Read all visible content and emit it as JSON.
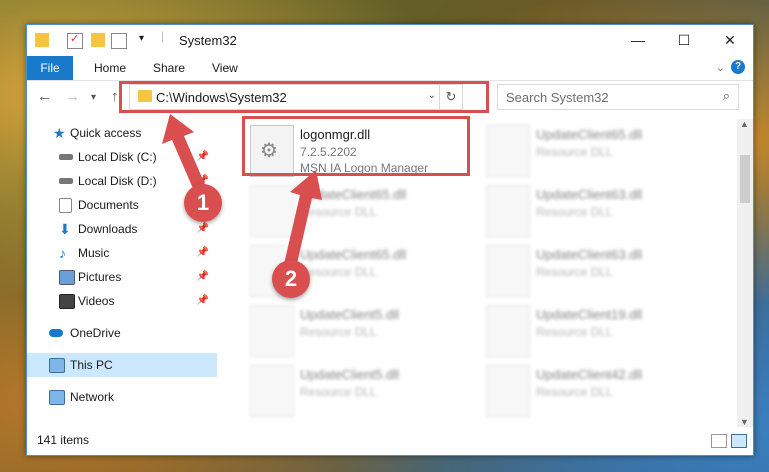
{
  "window": {
    "title": "System32"
  },
  "ribbon": {
    "tabs": [
      "File",
      "Home",
      "Share",
      "View"
    ]
  },
  "address": {
    "path": "C:\\Windows\\System32",
    "search_placeholder": "Search System32"
  },
  "sidebar": {
    "items": [
      {
        "label": "Quick access",
        "icon": "star-icon",
        "pinned": false
      },
      {
        "label": "Local Disk (C:)",
        "icon": "drive-icon",
        "pinned": true
      },
      {
        "label": "Local Disk (D:)",
        "icon": "drive-icon",
        "pinned": true
      },
      {
        "label": "Documents",
        "icon": "documents-icon",
        "pinned": true
      },
      {
        "label": "Downloads",
        "icon": "downloads-icon",
        "pinned": true
      },
      {
        "label": "Music",
        "icon": "music-icon",
        "pinned": true
      },
      {
        "label": "Pictures",
        "icon": "pictures-icon",
        "pinned": true
      },
      {
        "label": "Videos",
        "icon": "videos-icon",
        "pinned": true
      },
      {
        "label": "OneDrive",
        "icon": "cloud-icon",
        "pinned": false
      },
      {
        "label": "This PC",
        "icon": "computer-icon",
        "pinned": false
      },
      {
        "label": "Network",
        "icon": "network-icon",
        "pinned": false
      }
    ]
  },
  "files": {
    "primary": {
      "name": "logonmgr.dll",
      "version": "7.2.5.2202",
      "description": "MSN IA Logon Manager"
    },
    "grid": [
      {
        "name": "UpdateClient65.dll",
        "type": "Resource DLL"
      },
      {
        "name": "UpdateClient65.dll",
        "type": "Resource DLL"
      },
      {
        "name": "UpdateClient63.dll",
        "type": "Resource DLL"
      },
      {
        "name": "UpdateClient65.dll",
        "type": "Resource DLL"
      },
      {
        "name": "UpdateClient63.dll",
        "type": "Resource DLL"
      },
      {
        "name": "UpdateClient5.dll",
        "type": "Resource DLL"
      },
      {
        "name": "UpdateClient19.dll",
        "type": "Resource DLL"
      },
      {
        "name": "UpdateClient5.dll",
        "type": "Resource DLL"
      },
      {
        "name": "UpdateClient42.dll",
        "type": "Resource DLL"
      }
    ]
  },
  "status": {
    "count": "141 items"
  },
  "annotations": {
    "marker1": "1",
    "marker2": "2"
  },
  "colors": {
    "accent": "#1979ca",
    "highlight": "#d94f4f",
    "selection": "#cce8ff"
  }
}
